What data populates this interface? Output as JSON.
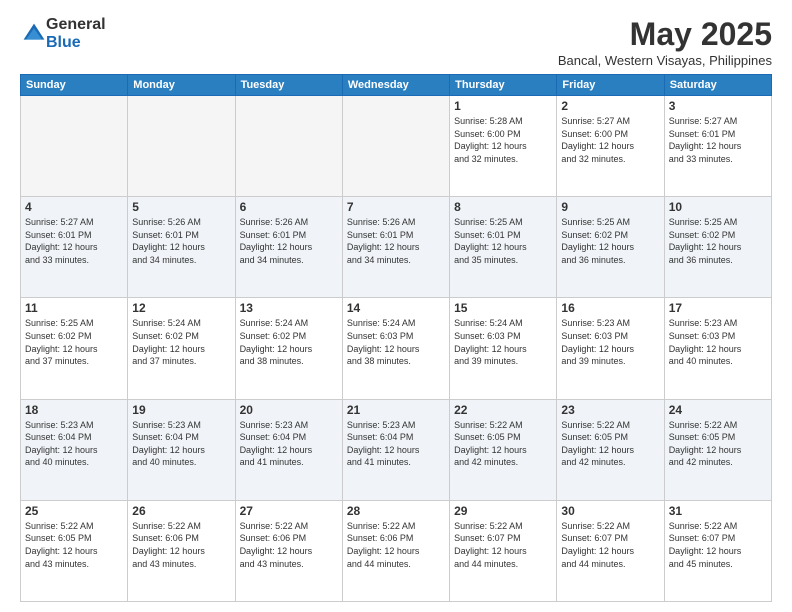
{
  "logo": {
    "general": "General",
    "blue": "Blue"
  },
  "title": "May 2025",
  "location": "Bancal, Western Visayas, Philippines",
  "weekdays": [
    "Sunday",
    "Monday",
    "Tuesday",
    "Wednesday",
    "Thursday",
    "Friday",
    "Saturday"
  ],
  "weeks": [
    [
      {
        "day": "",
        "info": ""
      },
      {
        "day": "",
        "info": ""
      },
      {
        "day": "",
        "info": ""
      },
      {
        "day": "",
        "info": ""
      },
      {
        "day": "1",
        "info": "Sunrise: 5:28 AM\nSunset: 6:00 PM\nDaylight: 12 hours\nand 32 minutes."
      },
      {
        "day": "2",
        "info": "Sunrise: 5:27 AM\nSunset: 6:00 PM\nDaylight: 12 hours\nand 32 minutes."
      },
      {
        "day": "3",
        "info": "Sunrise: 5:27 AM\nSunset: 6:01 PM\nDaylight: 12 hours\nand 33 minutes."
      }
    ],
    [
      {
        "day": "4",
        "info": "Sunrise: 5:27 AM\nSunset: 6:01 PM\nDaylight: 12 hours\nand 33 minutes."
      },
      {
        "day": "5",
        "info": "Sunrise: 5:26 AM\nSunset: 6:01 PM\nDaylight: 12 hours\nand 34 minutes."
      },
      {
        "day": "6",
        "info": "Sunrise: 5:26 AM\nSunset: 6:01 PM\nDaylight: 12 hours\nand 34 minutes."
      },
      {
        "day": "7",
        "info": "Sunrise: 5:26 AM\nSunset: 6:01 PM\nDaylight: 12 hours\nand 34 minutes."
      },
      {
        "day": "8",
        "info": "Sunrise: 5:25 AM\nSunset: 6:01 PM\nDaylight: 12 hours\nand 35 minutes."
      },
      {
        "day": "9",
        "info": "Sunrise: 5:25 AM\nSunset: 6:02 PM\nDaylight: 12 hours\nand 36 minutes."
      },
      {
        "day": "10",
        "info": "Sunrise: 5:25 AM\nSunset: 6:02 PM\nDaylight: 12 hours\nand 36 minutes."
      }
    ],
    [
      {
        "day": "11",
        "info": "Sunrise: 5:25 AM\nSunset: 6:02 PM\nDaylight: 12 hours\nand 37 minutes."
      },
      {
        "day": "12",
        "info": "Sunrise: 5:24 AM\nSunset: 6:02 PM\nDaylight: 12 hours\nand 37 minutes."
      },
      {
        "day": "13",
        "info": "Sunrise: 5:24 AM\nSunset: 6:02 PM\nDaylight: 12 hours\nand 38 minutes."
      },
      {
        "day": "14",
        "info": "Sunrise: 5:24 AM\nSunset: 6:03 PM\nDaylight: 12 hours\nand 38 minutes."
      },
      {
        "day": "15",
        "info": "Sunrise: 5:24 AM\nSunset: 6:03 PM\nDaylight: 12 hours\nand 39 minutes."
      },
      {
        "day": "16",
        "info": "Sunrise: 5:23 AM\nSunset: 6:03 PM\nDaylight: 12 hours\nand 39 minutes."
      },
      {
        "day": "17",
        "info": "Sunrise: 5:23 AM\nSunset: 6:03 PM\nDaylight: 12 hours\nand 40 minutes."
      }
    ],
    [
      {
        "day": "18",
        "info": "Sunrise: 5:23 AM\nSunset: 6:04 PM\nDaylight: 12 hours\nand 40 minutes."
      },
      {
        "day": "19",
        "info": "Sunrise: 5:23 AM\nSunset: 6:04 PM\nDaylight: 12 hours\nand 40 minutes."
      },
      {
        "day": "20",
        "info": "Sunrise: 5:23 AM\nSunset: 6:04 PM\nDaylight: 12 hours\nand 41 minutes."
      },
      {
        "day": "21",
        "info": "Sunrise: 5:23 AM\nSunset: 6:04 PM\nDaylight: 12 hours\nand 41 minutes."
      },
      {
        "day": "22",
        "info": "Sunrise: 5:22 AM\nSunset: 6:05 PM\nDaylight: 12 hours\nand 42 minutes."
      },
      {
        "day": "23",
        "info": "Sunrise: 5:22 AM\nSunset: 6:05 PM\nDaylight: 12 hours\nand 42 minutes."
      },
      {
        "day": "24",
        "info": "Sunrise: 5:22 AM\nSunset: 6:05 PM\nDaylight: 12 hours\nand 42 minutes."
      }
    ],
    [
      {
        "day": "25",
        "info": "Sunrise: 5:22 AM\nSunset: 6:05 PM\nDaylight: 12 hours\nand 43 minutes."
      },
      {
        "day": "26",
        "info": "Sunrise: 5:22 AM\nSunset: 6:06 PM\nDaylight: 12 hours\nand 43 minutes."
      },
      {
        "day": "27",
        "info": "Sunrise: 5:22 AM\nSunset: 6:06 PM\nDaylight: 12 hours\nand 43 minutes."
      },
      {
        "day": "28",
        "info": "Sunrise: 5:22 AM\nSunset: 6:06 PM\nDaylight: 12 hours\nand 44 minutes."
      },
      {
        "day": "29",
        "info": "Sunrise: 5:22 AM\nSunset: 6:07 PM\nDaylight: 12 hours\nand 44 minutes."
      },
      {
        "day": "30",
        "info": "Sunrise: 5:22 AM\nSunset: 6:07 PM\nDaylight: 12 hours\nand 44 minutes."
      },
      {
        "day": "31",
        "info": "Sunrise: 5:22 AM\nSunset: 6:07 PM\nDaylight: 12 hours\nand 45 minutes."
      }
    ]
  ]
}
